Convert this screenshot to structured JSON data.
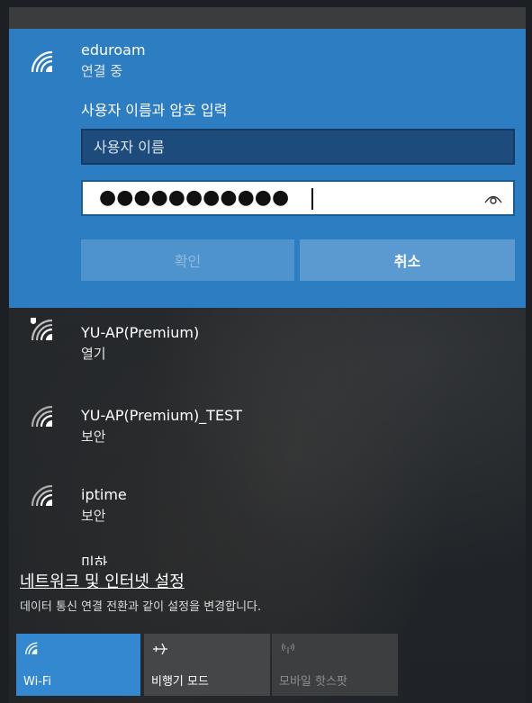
{
  "connecting_network": {
    "name": "eduroam",
    "status": "연결 중",
    "prompt": "사용자 이름과 암호 입력",
    "username_placeholder": "사용자 이름",
    "password_mask": "●●●●●●●●●●●",
    "ok_label": "확인",
    "cancel_label": "취소"
  },
  "networks": [
    {
      "name": "YU-AP(Premium)",
      "status": "열기",
      "icon": "wifi-shield-icon"
    },
    {
      "name": "YU-AP(Premium)_TEST",
      "status": "보안",
      "icon": "wifi-icon"
    },
    {
      "name": "iptime",
      "status": "보안",
      "icon": "wifi-icon"
    },
    {
      "name": "미하",
      "status": "",
      "icon": "wifi-icon"
    }
  ],
  "settings": {
    "link": "네트워크 및 인터넷 설정",
    "description": "데이터 통신 연결 전환과 같이 설정을 변경합니다."
  },
  "quick_actions": [
    {
      "label": "Wi-Fi",
      "icon": "wifi-icon",
      "active": true
    },
    {
      "label": "비행기 모드",
      "icon": "airplane-icon",
      "active": false
    },
    {
      "label": "모바일 핫스팟",
      "icon": "hotspot-icon",
      "active": false
    }
  ],
  "colors": {
    "accent": "#2c7dc2",
    "tile_active": "#3488cf",
    "tile_inactive": "#454647"
  }
}
